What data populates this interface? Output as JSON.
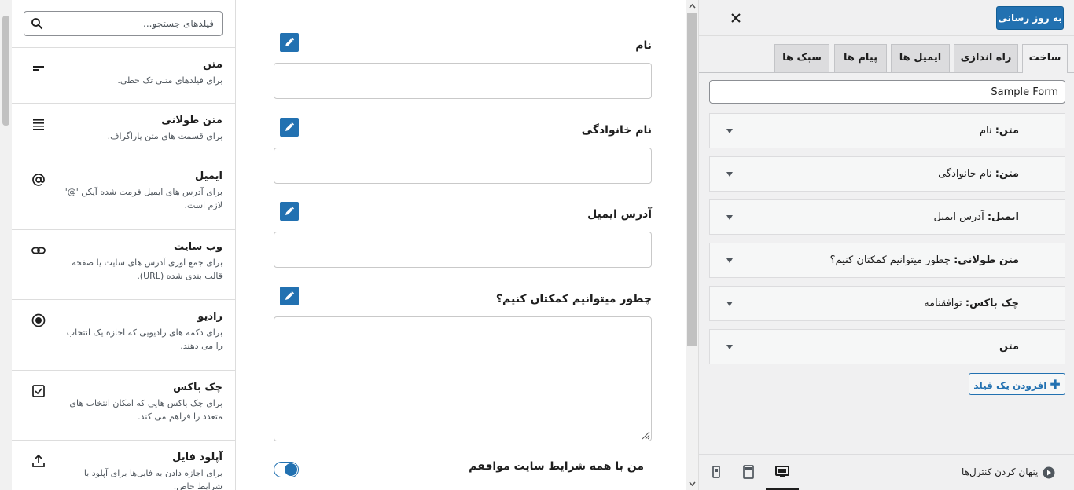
{
  "library": {
    "search_placeholder": "فیلدهای جستجو...",
    "items": [
      {
        "title": "متن",
        "desc": "برای فیلدهای متنی تک خطی.",
        "icon": "short-text-icon"
      },
      {
        "title": "متن طولانی",
        "desc": "برای قسمت های متن پاراگراف.",
        "icon": "paragraph-icon"
      },
      {
        "title": "ایمیل",
        "desc": "برای آدرس های ایمیل فرمت شده آیکن '@' لازم است.",
        "icon": "at-sign-icon"
      },
      {
        "title": "وب سایت",
        "desc": "برای جمع آوری آدرس های سایت یا صفحه قالب بندی شده (URL).",
        "icon": "link-icon"
      },
      {
        "title": "رادیو",
        "desc": "برای دکمه های رادیویی که اجازه یک انتخاب را می دهند.",
        "icon": "radio-icon"
      },
      {
        "title": "چک باکس",
        "desc": "برای چک باکس هایی که امکان انتخاب های متعدد را فراهم می کند.",
        "icon": "checkbox-icon"
      },
      {
        "title": "آپلود فایل",
        "desc": "برای اجازه دادن به فایل‌ها برای آپلود با شرایط خاص.",
        "icon": "upload-icon"
      }
    ]
  },
  "canvas": {
    "fields": [
      {
        "label": "نام"
      },
      {
        "label": "نام خانوادگی"
      },
      {
        "label": "آدرس ایمیل"
      },
      {
        "label": "چطور میتوانیم کمکتان کنیم؟"
      }
    ],
    "consent_label": "من با همه شرایط سایت موافقم"
  },
  "settings": {
    "update_label": "به روز رسانی",
    "tabs": [
      "ساخت",
      "راه اندازی",
      "ایمیل ها",
      "پیام ها",
      "سبک ها"
    ],
    "form_name": "Sample Form",
    "accordions": [
      {
        "type": "متن:",
        "name": "نام"
      },
      {
        "type": "متن:",
        "name": "نام خانوادگی"
      },
      {
        "type": "ایمیل:",
        "name": "آدرس ایمیل"
      },
      {
        "type": "متن طولانی:",
        "name": "چطور میتوانیم کمکتان کنیم؟"
      },
      {
        "type": "چک باکس:",
        "name": "توافقنامه"
      },
      {
        "type": "متن",
        "name": ""
      }
    ],
    "add_field_label": "افزودن یک فیلد",
    "hide_controls_label": "پنهان کردن کنترل‌ها"
  },
  "colors": {
    "accent": "#2271b1",
    "panel_bg": "#f0f0f1"
  }
}
